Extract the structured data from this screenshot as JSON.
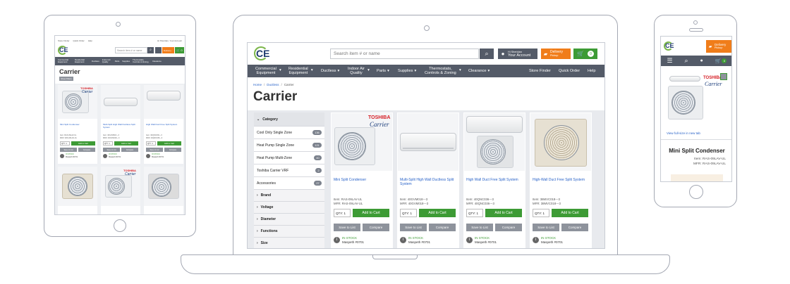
{
  "laptop": {
    "search_placeholder": "Search item # or name",
    "account_greeting": "Hi Sheridan",
    "account_label": "Your Account",
    "delivery_label": "Delivery",
    "delivery_sub": "Pickup",
    "cart_count": "0",
    "nav": [
      {
        "label": "Commercial Equipment",
        "l1": "Commercial",
        "l2": "Equipment"
      },
      {
        "label": "Residential Equipment",
        "l1": "Residential",
        "l2": "Equipment"
      },
      {
        "label": "Ductless"
      },
      {
        "label": "Indoor Air Quality",
        "l1": "Indoor Air",
        "l2": "Quality"
      },
      {
        "label": "Parts"
      },
      {
        "label": "Supplies"
      },
      {
        "label": "Thermostats, Controls & Zoning",
        "l1": "Thermostats,",
        "l2": "Controls & Zoning"
      },
      {
        "label": "Clearance"
      }
    ],
    "nav_right": [
      "Store Finder",
      "Quick Order",
      "Help"
    ],
    "breadcrumb": [
      "Home",
      "Ductless",
      "Carrier"
    ],
    "page_title": "Carrier",
    "category_header": "Category",
    "categories": [
      {
        "name": "Cool Only Single Zone",
        "count": "136"
      },
      {
        "name": "Heat Pump Single Zone",
        "count": "121"
      },
      {
        "name": "Heat Pump Multi-Zone",
        "count": "40"
      },
      {
        "name": "Toshiba Carrier VRF",
        "count": "2"
      },
      {
        "name": "Accessories",
        "count": "27"
      }
    ],
    "filters": [
      "Brand",
      "Voltage",
      "Diameter",
      "Functions",
      "Size"
    ],
    "products": [
      {
        "name": "Mini Split Condenser",
        "item": "Item: RAS-09LAV-UL",
        "mfr": "MFR: RAS-09LAV-UL"
      },
      {
        "name": "Multi-Split High Wall Ductless Split System",
        "item": "Item: 40GVM018---3",
        "mfr": "MFR: 40GVM018---3"
      },
      {
        "name": "High Wall Duct Free Split System",
        "item": "Item: 40QNC036---3",
        "mfr": "MFR: 40QNC036---3"
      },
      {
        "name": "High-Wall Duct Free Split System",
        "item": "Item: 38MVC018---3",
        "mfr": "MFR: 38MVC018---3"
      }
    ],
    "qty_label": "QTY: 1",
    "add_to_cart": "Add to Cart",
    "save_to_list": "Save to List",
    "compare": "Compare",
    "stock_status": "IN STOCK",
    "stock_location": "Maspeth #0701",
    "brand_toshiba": "TOSHIBA",
    "brand_carrier": "Carrier"
  },
  "tablet": {
    "top_links": [
      "Store Finder",
      "Quick Order",
      "Help"
    ],
    "account_text": "Hi Sheridan, Your Account",
    "search_placeholder": "Search item # or name",
    "delivery_label": "Delivery",
    "cart_count": "0",
    "nav": [
      "Commercial Equipment",
      "Residential Equipment",
      "Ductless",
      "Indoor Air Quality",
      "Parts",
      "Supplies",
      "Thermostats, Controls & Zoning",
      "Clearance"
    ],
    "page_title": "Carrier",
    "show_filters": "Show Filters",
    "products": [
      {
        "name": "Mini Split Condenser",
        "item": "Item: RAS-09LAV-UL",
        "mfr": "MFR: RAS-09LAV-UL"
      },
      {
        "name": "Multi-Split High Wall Ductless Split System",
        "item": "Item: 40GVM018---3",
        "mfr": "MFR: 40GVM018---3"
      },
      {
        "name": "High Wall Duct Free Split System",
        "item": "Item: 40QNC036---3",
        "mfr": "MFR: 40QNC036---3"
      }
    ],
    "qty_label": "QTY: 1",
    "add_to_cart": "Add to Cart",
    "save_to_list": "Save to List",
    "compare": "Compare",
    "stock_status": "IN STOCK",
    "stock_location": "Maspeth #0701"
  },
  "phone": {
    "delivery_label": "Delivery",
    "delivery_sub": "Pickup",
    "cart_count": "0",
    "view_full": "View full-size in new tab",
    "product_name": "Mini Split Condenser",
    "item": "Item: RAS-09LAV-UL",
    "mfr": "MFR: RAS-09LAV-UL",
    "brand_toshiba": "TOSHIBA",
    "brand_carrier": "Carrier"
  },
  "colors": {
    "nav_bg": "#545b68",
    "green": "#3d9b35",
    "orange": "#f07d1a",
    "link": "#2a63c8",
    "device_outline": "#a4a8b3"
  }
}
